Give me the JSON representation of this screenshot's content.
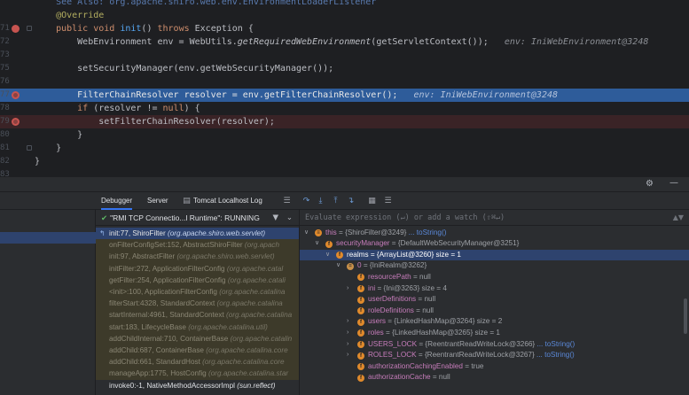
{
  "editor": {
    "lines": [
      {
        "ln": "",
        "code": [
          {
            "c": "link",
            "t": "    See Also: org.apache.shiro.web.env.EnvironmentLoaderListener"
          }
        ]
      },
      {
        "ln": "",
        "code": [
          {
            "c": "ann",
            "t": "    @Override"
          }
        ]
      },
      {
        "ln": "71",
        "code": [
          {
            "c": "kw",
            "t": "    public void "
          },
          {
            "c": "fn",
            "t": "init"
          },
          {
            "c": "pl",
            "t": "() "
          },
          {
            "c": "kw",
            "t": "throws "
          },
          {
            "c": "pl",
            "t": "Exception {"
          }
        ]
      },
      {
        "ln": "72",
        "code": [
          {
            "c": "pl",
            "t": "        WebEnvironment env = WebUtils."
          },
          {
            "c": "it",
            "t": "getRequiredWebEnvironment"
          },
          {
            "c": "pl",
            "t": "(getServletContext());  "
          },
          {
            "c": "hint",
            "t": " env: IniWebEnvironment@3248"
          }
        ]
      },
      {
        "ln": "73",
        "code": [
          {
            "c": "pl",
            "t": ""
          }
        ]
      },
      {
        "ln": "75",
        "code": [
          {
            "c": "pl",
            "t": "        setSecurityManager(env.getWebSecurityManager());"
          }
        ]
      },
      {
        "ln": "76",
        "code": [
          {
            "c": "pl",
            "t": ""
          }
        ]
      },
      {
        "ln": "77",
        "code": [
          {
            "c": "pl",
            "t": "        FilterChainResolver resolver = env.getFilterChainResolver();  "
          },
          {
            "c": "hint",
            "t": " env: IniWebEnvironment@3248"
          }
        ]
      },
      {
        "ln": "78",
        "code": [
          {
            "c": "kw",
            "t": "        if "
          },
          {
            "c": "pl",
            "t": "(resolver != "
          },
          {
            "c": "kw",
            "t": "null"
          },
          {
            "c": "pl",
            "t": ") {"
          }
        ]
      },
      {
        "ln": "79",
        "code": [
          {
            "c": "pl",
            "t": "            setFilterChainResolver(resolver);"
          }
        ]
      },
      {
        "ln": "80",
        "code": [
          {
            "c": "pl",
            "t": "        }"
          }
        ]
      },
      {
        "ln": "81",
        "code": [
          {
            "c": "pl",
            "t": "    }"
          }
        ]
      },
      {
        "ln": "82",
        "code": [
          {
            "c": "pl",
            "t": "}"
          }
        ]
      },
      {
        "ln": "83",
        "code": [
          {
            "c": "pl",
            "t": ""
          }
        ]
      }
    ]
  },
  "debugger": {
    "tabs": [
      "Debugger",
      "Server",
      "Tomcat Localhost Log"
    ],
    "thread_label": "\"RMI TCP Connectio...l Runtime\": RUNNING",
    "evaluate_placeholder": "Evaluate expression (↵) or add a watch (⇧⌘↵)",
    "frames": [
      {
        "name": "init:77, ShiroFilter ",
        "pkg": "(org.apache.shiro.web.servlet)",
        "style": "sel"
      },
      {
        "name": "onFilterConfigSet:152, AbstractShiroFilter ",
        "pkg": "(org.apach",
        "style": "lib"
      },
      {
        "name": "init:97, AbstractFilter ",
        "pkg": "(org.apache.shiro.web.servlet)",
        "style": "lib"
      },
      {
        "name": "initFilter:272, ApplicationFilterConfig ",
        "pkg": "(org.apache.catal",
        "style": "lib"
      },
      {
        "name": "getFilter:254, ApplicationFilterConfig ",
        "pkg": "(org.apache.catali",
        "style": "lib"
      },
      {
        "name": "<init>:100, ApplicationFilterConfig ",
        "pkg": "(org.apache.catalina",
        "style": "lib"
      },
      {
        "name": "filterStart:4328, StandardContext ",
        "pkg": "(org.apache.catalina",
        "style": "lib"
      },
      {
        "name": "startInternal:4961, StandardContext ",
        "pkg": "(org.apache.catalina",
        "style": "lib"
      },
      {
        "name": "start:183, LifecycleBase ",
        "pkg": "(org.apache.catalina.util)",
        "style": "lib"
      },
      {
        "name": "addChildInternal:710, ContainerBase ",
        "pkg": "(org.apache.catalin",
        "style": "lib"
      },
      {
        "name": "addChild:687, ContainerBase ",
        "pkg": "(org.apache.catalina.core",
        "style": "lib"
      },
      {
        "name": "addChild:661, StandardHost ",
        "pkg": "(org.apache.catalina.core",
        "style": "lib"
      },
      {
        "name": "manageApp:1775, HostConfig ",
        "pkg": "(org.apache.catalina.star",
        "style": "lib"
      },
      {
        "name": "invoke0:-1, NativeMethodAccessorImpl ",
        "pkg": "(sun.reflect)",
        "style": "norm"
      }
    ],
    "variables": [
      {
        "indent": 0,
        "exp": "∨",
        "icon": "p",
        "name": "this",
        "value": " = {ShiroFilter@3249} ",
        "link": "... toString()",
        "sel": false
      },
      {
        "indent": 1,
        "exp": "∨",
        "icon": "f",
        "name": "securityManager",
        "value": " = {DefaultWebSecurityManager@3251}",
        "link": "",
        "sel": false
      },
      {
        "indent": 2,
        "exp": "∨",
        "icon": "f",
        "name": "realms",
        "value": " = {ArrayList@3260}  size = 1",
        "link": "",
        "sel": true
      },
      {
        "indent": 3,
        "exp": "∨",
        "icon": "eq",
        "name": "0",
        "value": " = {IniRealm@3262}",
        "link": "",
        "sel": false
      },
      {
        "indent": 4,
        "exp": "",
        "icon": "f",
        "name": "resourcePath",
        "value": " = null",
        "link": "",
        "sel": false
      },
      {
        "indent": 4,
        "exp": "›",
        "icon": "f",
        "name": "ini",
        "value": " = {Ini@3263}  size = 4",
        "link": "",
        "sel": false
      },
      {
        "indent": 4,
        "exp": "",
        "icon": "f",
        "name": "userDefinitions",
        "value": " = null",
        "link": "",
        "sel": false
      },
      {
        "indent": 4,
        "exp": "",
        "icon": "f",
        "name": "roleDefinitions",
        "value": " = null",
        "link": "",
        "sel": false
      },
      {
        "indent": 4,
        "exp": "›",
        "icon": "f",
        "name": "users",
        "value": " = {LinkedHashMap@3264}  size = 2",
        "link": "",
        "sel": false
      },
      {
        "indent": 4,
        "exp": "›",
        "icon": "f",
        "name": "roles",
        "value": " = {LinkedHashMap@3265}  size = 1",
        "link": "",
        "sel": false
      },
      {
        "indent": 4,
        "exp": "›",
        "icon": "f",
        "name": "USERS_LOCK",
        "value": " = {ReentrantReadWriteLock@3266} ",
        "link": "... toString()",
        "sel": false
      },
      {
        "indent": 4,
        "exp": "›",
        "icon": "f",
        "name": "ROLES_LOCK",
        "value": " = {ReentrantReadWriteLock@3267} ",
        "link": "... toString()",
        "sel": false
      },
      {
        "indent": 4,
        "exp": "",
        "icon": "f",
        "name": "authorizationCachingEnabled",
        "value": " = true",
        "link": "",
        "sel": false
      },
      {
        "indent": 4,
        "exp": "",
        "icon": "f",
        "name": "authorizationCache",
        "value": " = null",
        "link": "",
        "sel": false
      }
    ]
  }
}
